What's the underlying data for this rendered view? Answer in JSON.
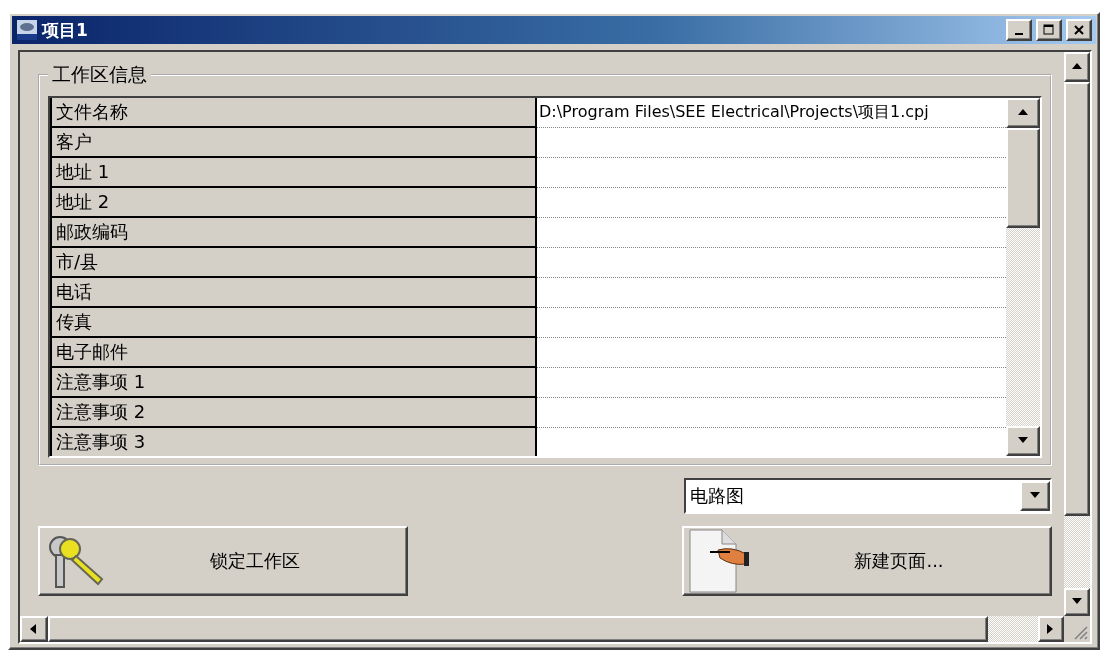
{
  "window": {
    "title": "项目1"
  },
  "workspace_info": {
    "title": "工作区信息",
    "rows": [
      {
        "label": "文件名称",
        "value": "D:\\Program Files\\SEE Electrical\\Projects\\项目1.cpj"
      },
      {
        "label": "客户"
      },
      {
        "label": "地址 1"
      },
      {
        "label": "地址 2"
      },
      {
        "label": "邮政编码"
      },
      {
        "label": "市/县"
      },
      {
        "label": "电话"
      },
      {
        "label": "传真"
      },
      {
        "label": "电子邮件"
      },
      {
        "label": "注意事项 1"
      },
      {
        "label": "注意事项 2"
      },
      {
        "label": "注意事项 3"
      }
    ]
  },
  "page_type": {
    "value": "电路图"
  },
  "buttons": [
    {
      "label": "锁定工作区",
      "kind": "lock"
    },
    {
      "label": "新建页面...",
      "kind": "new_page"
    }
  ]
}
